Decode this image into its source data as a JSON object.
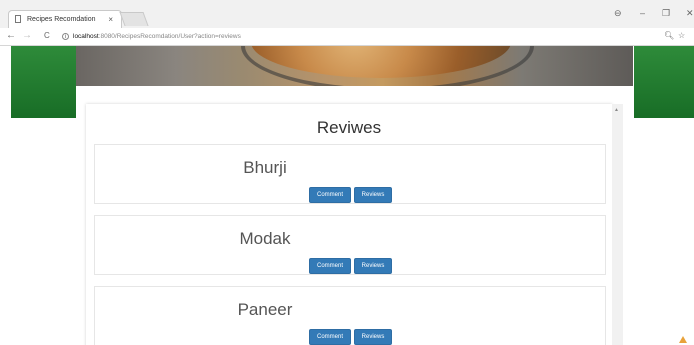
{
  "browser": {
    "tab_title": "Recipes Recomdation",
    "tab_close": "×",
    "url_host": "localhost",
    "url_rest": ":8080/RecipesRecomdation/User?action=reviews",
    "nav": {
      "back": "←",
      "forward": "→",
      "reload": "C"
    },
    "window": {
      "profile": "⊖",
      "minimize": "–",
      "restore": "❐",
      "close": "✕"
    },
    "addr_icons": {
      "zoom": "🔍︎",
      "star": "☆"
    }
  },
  "page": {
    "heading": "Reviwes",
    "items": [
      {
        "name": "Bhurji",
        "comment_label": "Comment",
        "reviews_label": "Reviews"
      },
      {
        "name": "Modak",
        "comment_label": "Comment",
        "reviews_label": "Reviews"
      },
      {
        "name": "Paneer",
        "comment_label": "Comment",
        "reviews_label": "Reviews"
      }
    ]
  },
  "colors": {
    "side_green": "#1f7a2e",
    "button_blue": "#337ab7"
  }
}
